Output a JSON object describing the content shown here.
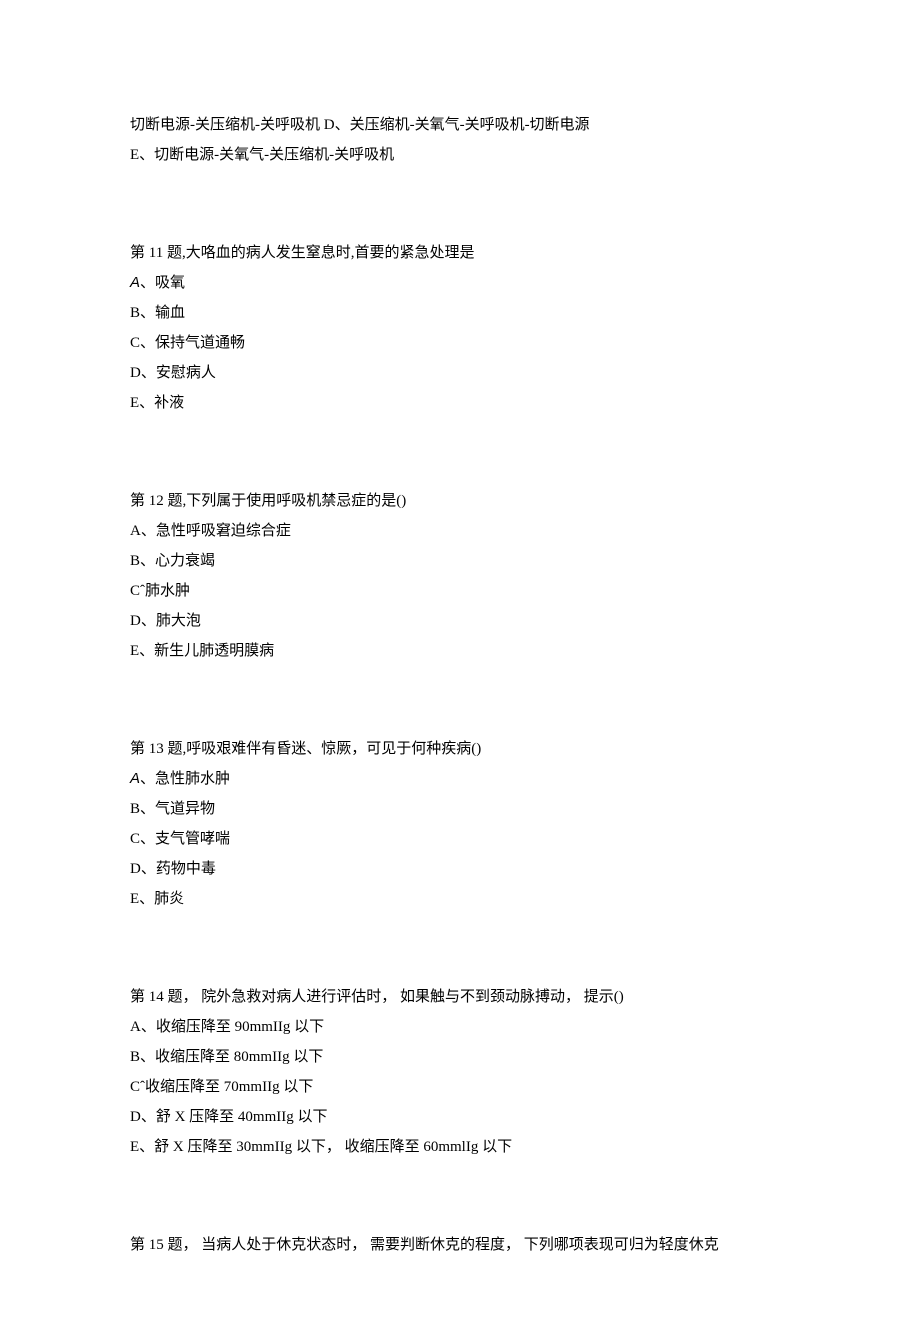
{
  "prelude": {
    "line1": "切断电源-关压缩机-关呼吸机 D、关压缩机-关氧气-关呼吸机-切断电源",
    "line2": "E、切断电源-关氧气-关压缩机-关呼吸机"
  },
  "q11": {
    "head": "第 11 题,大咯血的病人发生窒息时,首要的紧急处理是",
    "a_pre": "A",
    "a": "、吸氧",
    "b": "B、输血",
    "c": "C、保持气道通畅",
    "d": "D、安慰病人",
    "e": "E、补液"
  },
  "q12": {
    "head": "第 12 题,下列属于使用呼吸机禁忌症的是()",
    "a": "A、急性呼吸窘迫综合症",
    "b": "B、心力衰竭",
    "c": "Cˆ肺水肿",
    "d": "D、肺大泡",
    "e": "E、新生儿肺透明膜病"
  },
  "q13": {
    "head": "第 13 题,呼吸艰难伴有昏迷、惊厥，可见于何种疾病()",
    "a_pre": "A",
    "a": "、急性肺水肿",
    "b": "B、气道异物",
    "c": "C、支气管哮喘",
    "d": "D、药物中毒",
    "e": "E、肺炎"
  },
  "q14": {
    "head": "第 14 题， 院外急救对病人进行评估时， 如果触与不到颈动脉搏动， 提示()",
    "a": "A、收缩压降至 90mmIIg 以下",
    "b": "B、收缩压降至 80mmIIg 以下",
    "c": "Cˆ收缩压降至 70mmIIg 以下",
    "d": "D、舒 X 压降至 40mmIIg 以下",
    "e": "E、舒 X 压降至 30mmIIg 以下， 收缩压降至 60mmlIg 以下"
  },
  "q15": {
    "head": "第 15 题， 当病人处于休克状态时， 需要判断休克的程度， 下列哪项表现可归为轻度休克"
  }
}
